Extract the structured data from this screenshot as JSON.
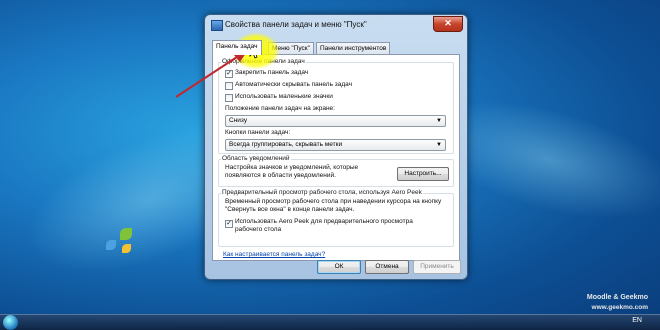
{
  "window": {
    "title": "Свойства панели задач и меню \"Пуск\"",
    "close_label": "✕"
  },
  "tabs": [
    {
      "label": "Панель задач",
      "active": true
    },
    {
      "label": "Меню \"Пуск\"",
      "active": false
    },
    {
      "label": "Панели инструментов",
      "active": false
    }
  ],
  "appearance": {
    "group_label": "Оформление панели задач",
    "options": [
      {
        "label": "Закрепить панель задач",
        "checked": true
      },
      {
        "label": "Автоматически скрывать панель задач",
        "checked": false
      },
      {
        "label": "Использовать маленькие значки",
        "checked": false
      }
    ],
    "position_label": "Положение панели задач на экране:",
    "position_value": "Снизу",
    "buttons_label": "Кнопки панели задач:",
    "buttons_value": "Всегда группировать, скрывать метки"
  },
  "notification": {
    "group_label": "Область уведомлений",
    "text": "Настройка значков и уведомлений, которые появляются в области уведомлений.",
    "button_label": "Настроить..."
  },
  "aero_peek": {
    "group_label": "Предварительный просмотр рабочего стола, используя Aero Peek",
    "text": "Временный просмотр рабочего стола при наведении курсора на кнопку \"Свернуть все окна\" в конце панели задач.",
    "option": {
      "label": "Использовать Aero Peek для предварительного просмотра рабочего стола",
      "checked": true
    }
  },
  "help_link": "Как настраивается панель задач?",
  "footer": {
    "ok": "ОК",
    "cancel": "Отмена",
    "apply": "Применить"
  },
  "taskbar": {
    "lang": "EN"
  },
  "watermark": {
    "line1": "Moodle & Geekmo",
    "line2": "www.geekmo.com"
  },
  "colors": {
    "annotation_arrow": "#c0282d",
    "highlight": "#ffff00",
    "desktop": "#1a78c2"
  }
}
